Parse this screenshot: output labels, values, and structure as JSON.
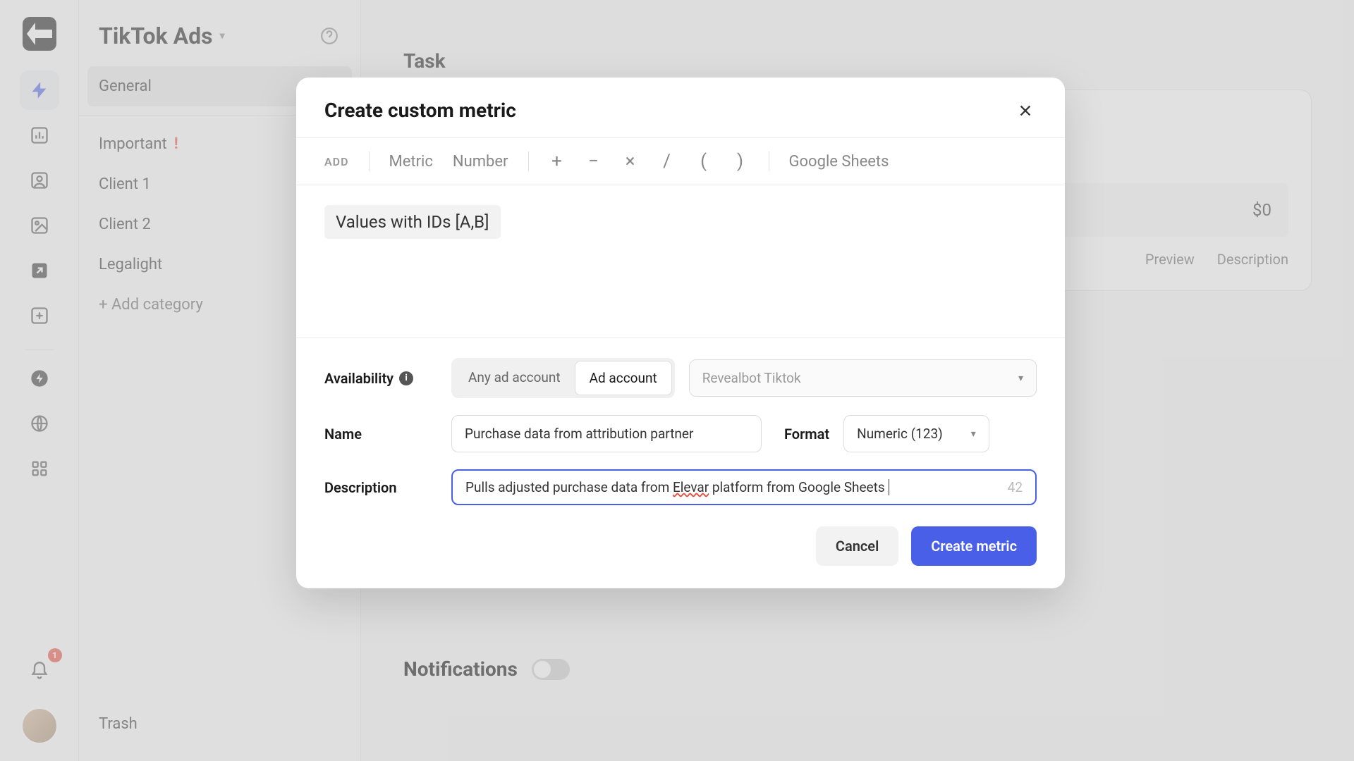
{
  "rail": {
    "notification_count": "1"
  },
  "sidebar": {
    "title": "TikTok Ads",
    "items": [
      "General",
      "Important",
      "Client 1",
      "Client 2",
      "Legalight"
    ],
    "add_category": "+ Add category",
    "trash": "Trash"
  },
  "main": {
    "task_label": "Task",
    "value": "$0",
    "preview": "Preview",
    "description": "Description",
    "notifications_label": "Notifications"
  },
  "modal": {
    "title": "Create custom metric",
    "toolbar": {
      "add": "ADD",
      "metric": "Metric",
      "number": "Number",
      "google_sheets": "Google Sheets"
    },
    "formula_chip": "Values with IDs [A,B]",
    "availability": {
      "label": "Availability",
      "any": "Any ad account",
      "account": "Ad account",
      "select_placeholder": "Revealbot Tiktok"
    },
    "name": {
      "label": "Name",
      "value": "Purchase data from attribution partner"
    },
    "format": {
      "label": "Format",
      "value": "Numeric (123)"
    },
    "description": {
      "label": "Description",
      "value_pre": "Pulls adjusted purchase data from ",
      "value_mid": "Elevar",
      "value_post": " platform from Google Sheets",
      "count": "42"
    },
    "buttons": {
      "cancel": "Cancel",
      "create": "Create metric"
    }
  }
}
